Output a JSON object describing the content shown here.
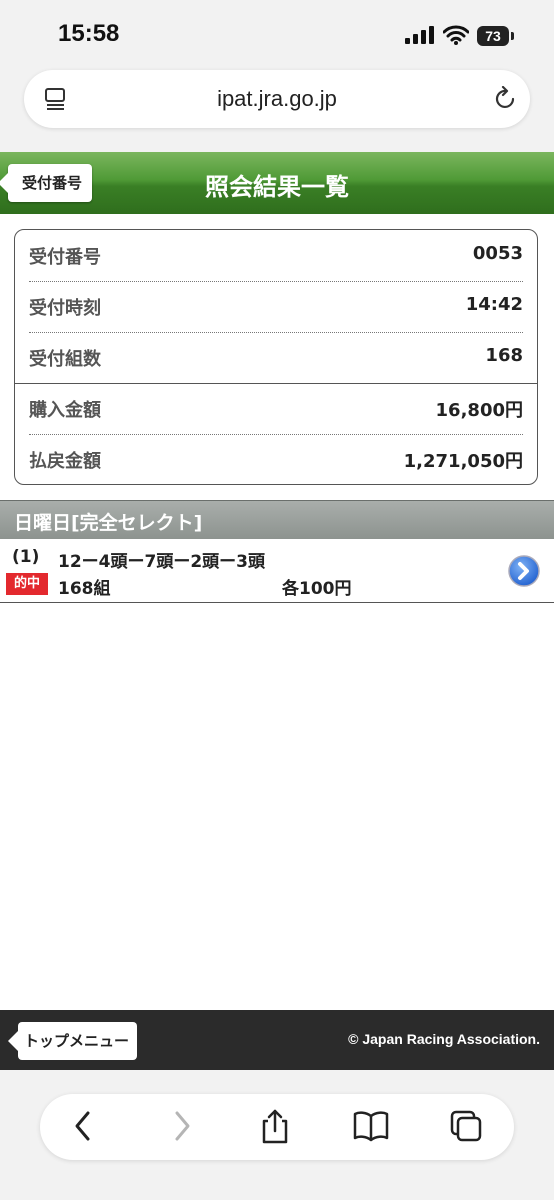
{
  "status_bar": {
    "time": "15:58",
    "battery": "73"
  },
  "browser": {
    "url": "ipat.jra.go.jp"
  },
  "header": {
    "back_label": "受付番号",
    "title": "照会結果一覧"
  },
  "summary": [
    {
      "label": "受付番号",
      "value": "0053"
    },
    {
      "label": "受付時刻",
      "value": "14:42"
    },
    {
      "label": "受付組数",
      "value": "168"
    },
    {
      "label": "購入金額",
      "value": "16,800円"
    },
    {
      "label": "払戻金額",
      "value": "1,271,050円"
    }
  ],
  "section": {
    "title": "日曜日[完全セレクト]"
  },
  "bet": {
    "number": "(1)",
    "combination": "12ー4頭ー7頭ー2頭ー3頭",
    "result_badge": "的中",
    "count": "168組",
    "each_amount": "各100円"
  },
  "footer": {
    "top_menu_label": "トップメニュー",
    "copyright": "© Japan Racing Association."
  },
  "colors": {
    "header_green": "#3a7f25",
    "hit_red": "#e3292e",
    "section_gray": "#8d938f",
    "footer_dark": "#2b2b2b"
  }
}
